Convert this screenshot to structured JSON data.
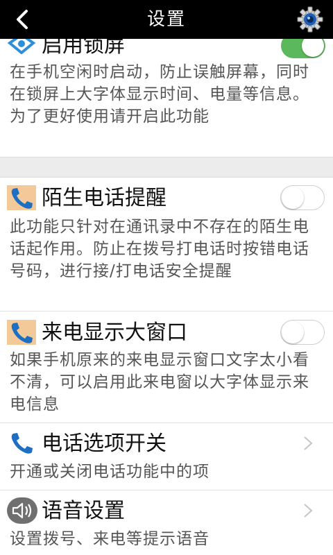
{
  "header": {
    "title": "设置"
  },
  "settings": [
    {
      "title": "启用锁屏",
      "description": "在手机空闲时启动，防止误触屏幕，同时在锁屏上大字体显示时间、电量等信息。为了更好使用请开启此功能",
      "control": "toggle",
      "enabled": true,
      "icon": "lock-screen-icon"
    },
    {
      "title": "陌生电话提醒",
      "description": "此功能只针对在通讯录中不存在的陌生电话起作用。防止在拨号打电话时按错电话号码，进行接/打电话安全提醒",
      "control": "toggle",
      "enabled": false,
      "icon": "phone-icon"
    },
    {
      "title": "来电显示大窗口",
      "description": "如果手机原来的来电显示窗口文字太小看不清，可以启用此来电窗以大字体显示来电信息",
      "control": "toggle",
      "enabled": false,
      "icon": "phone-icon"
    },
    {
      "title": "电话选项开关",
      "description": "开通或关闭电话功能中的项",
      "control": "chevron",
      "icon": "phone-icon"
    },
    {
      "title": "语音设置",
      "description": "设置拨号、来电等提示语音",
      "control": "chevron",
      "icon": "speaker-icon"
    }
  ],
  "colors": {
    "toggle_on": "#5cb85c",
    "phone_icon": "#1e6fc4",
    "phone_icon_bg": "#f4c99a",
    "header_bg": "#000000"
  }
}
